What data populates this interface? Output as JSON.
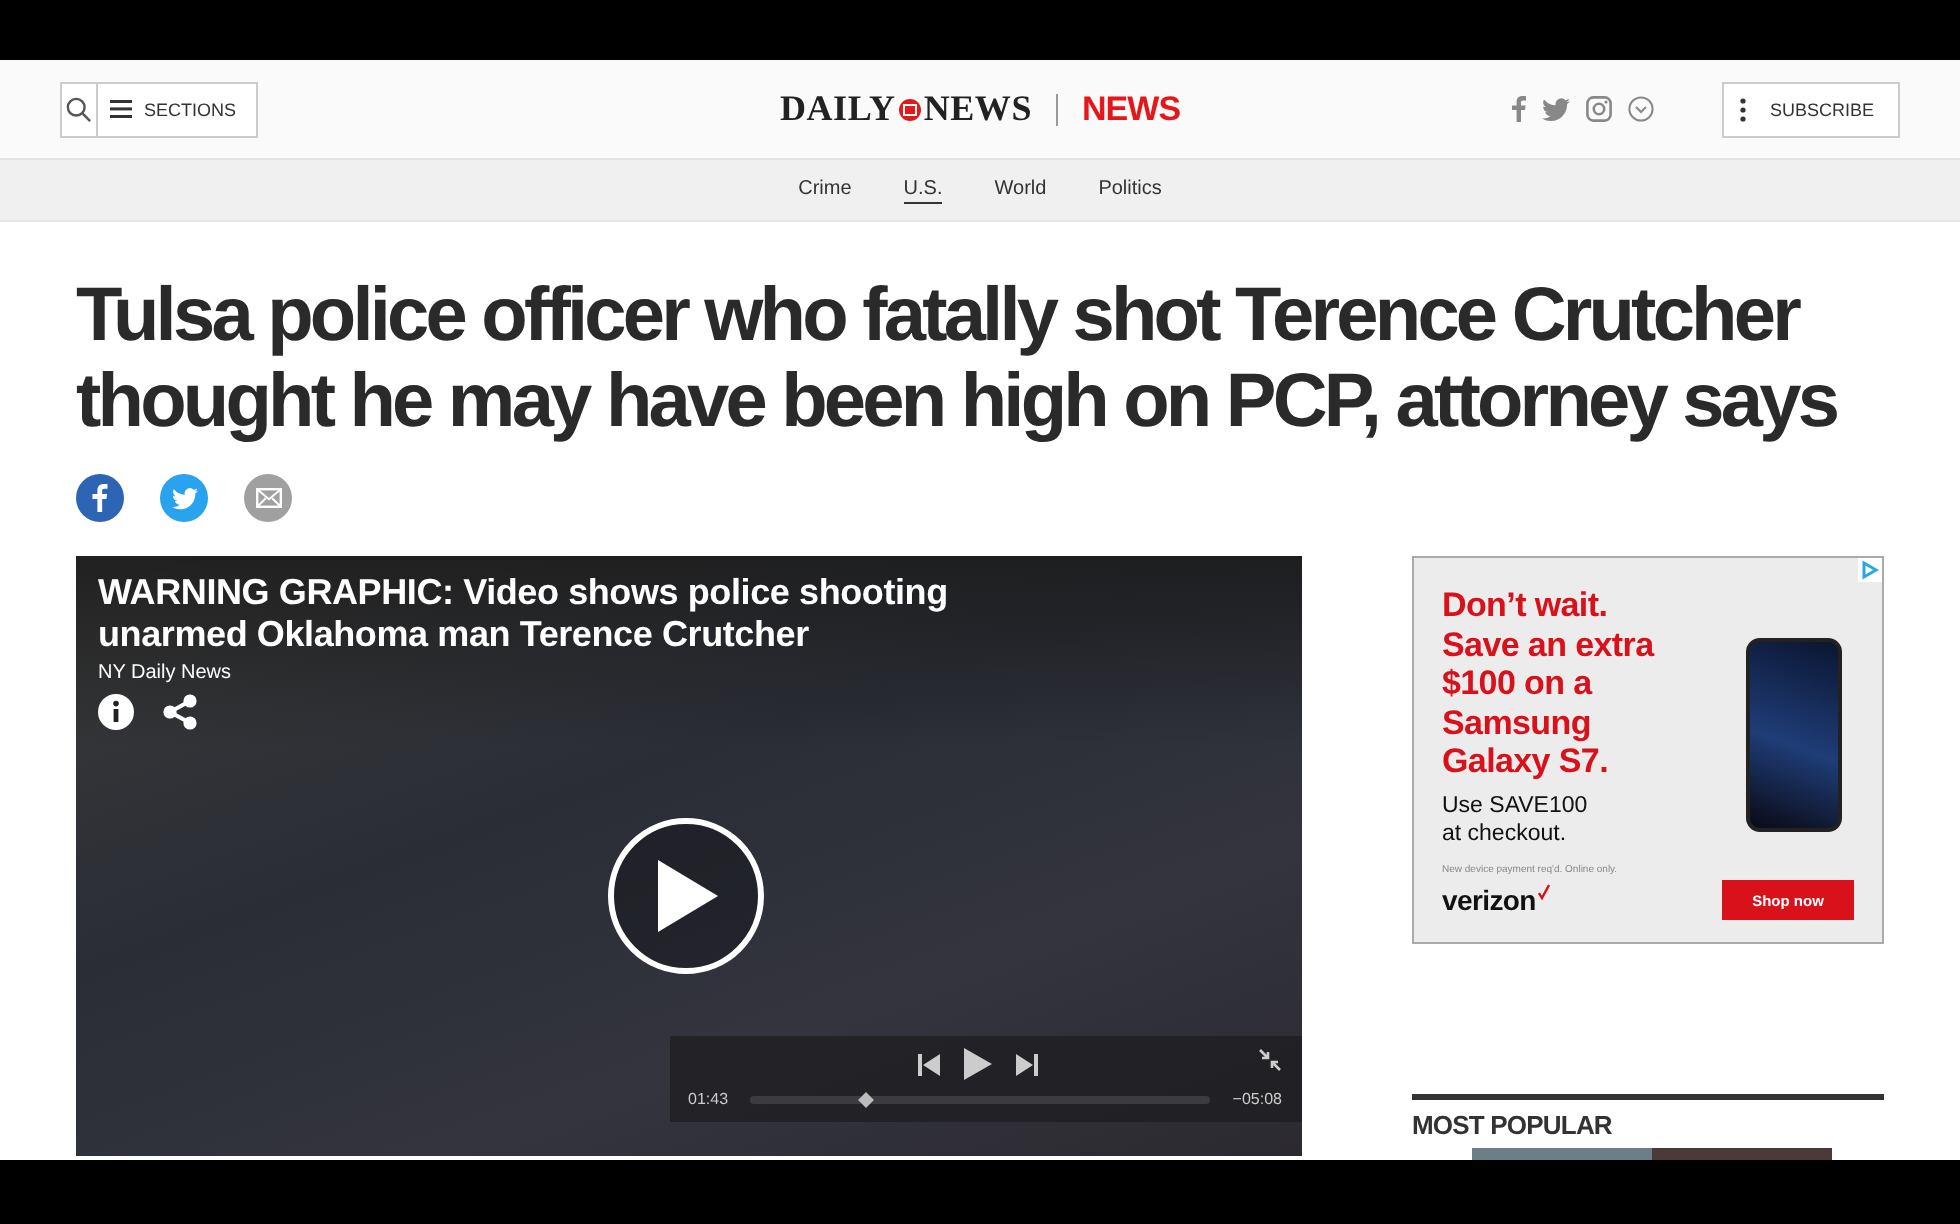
{
  "header": {
    "sections_label": "SECTIONS",
    "logo": {
      "left": "DAILY",
      "right": "NEWS"
    },
    "section_title": "NEWS",
    "subscribe_label": "SUBSCRIBE"
  },
  "nav": [
    {
      "label": "Crime",
      "selected": false
    },
    {
      "label": "U.S.",
      "selected": true
    },
    {
      "label": "World",
      "selected": false
    },
    {
      "label": "Politics",
      "selected": false
    }
  ],
  "article": {
    "headline": "Tulsa police officer who fatally shot Terence Crutcher thought he may have been high on PCP, attorney says",
    "share": [
      {
        "kind": "facebook",
        "color": "#2d64b3"
      },
      {
        "kind": "twitter",
        "color": "#2aa3ef"
      },
      {
        "kind": "email",
        "color": "#a0a0a0"
      }
    ]
  },
  "video": {
    "title": "WARNING GRAPHIC: Video shows police shooting unarmed Oklahoma man Terence Crutcher",
    "source": "NY Daily News",
    "elapsed": "01:43",
    "remaining": "−05:08",
    "level": 0.25
  },
  "ad": {
    "headline": "Don’t wait. Save an extra $100 on a Samsung Galaxy S7.",
    "offer": "Use SAVE100 at checkout.",
    "fine_print": "New device payment req'd. Online only.",
    "brand": "verizon",
    "button": "Shop now"
  },
  "most_popular": {
    "title": "MOST POPULAR"
  }
}
